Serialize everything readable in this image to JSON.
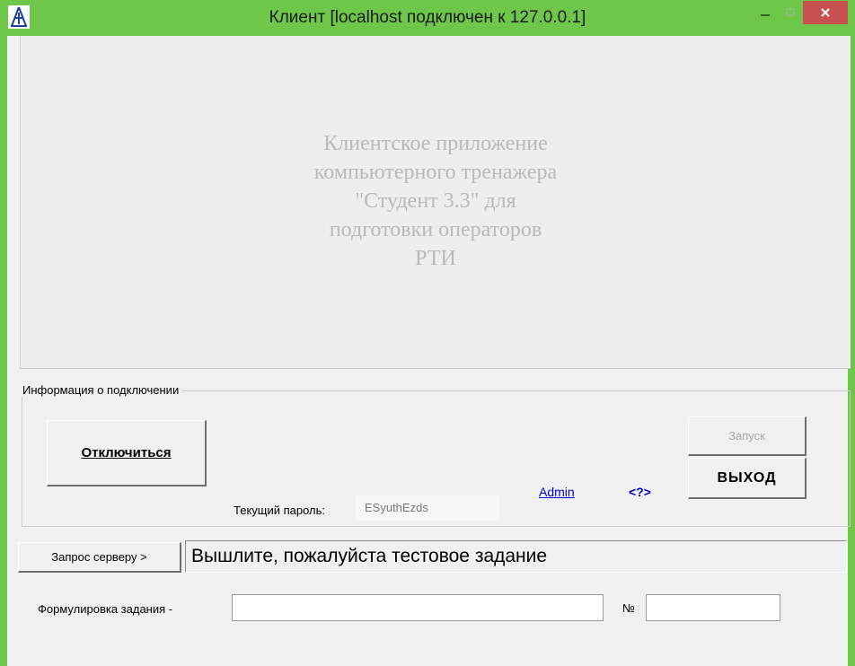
{
  "window": {
    "title": "Клиент [localhost подключен к 127.0.0.1]",
    "icon": "app-logo-icon",
    "frame_color": "#6fc74a",
    "close_color": "#c75050"
  },
  "banner": {
    "lines": [
      "Клиентское приложение",
      "компьютерного тренажера",
      "\"Студент 3.3\" для",
      "подготовки операторов",
      "РТИ"
    ]
  },
  "connection": {
    "legend": "Информация о подключении",
    "disconnect_label": "Отключиться",
    "launch_label": "Запуск",
    "exit_label": "ВЫХОД",
    "password_label": "Текущий пароль:",
    "password_value": "ESyuthEzds",
    "admin_link": "Admin",
    "help_link": "<?>"
  },
  "request": {
    "button_label": "Запрос серверу >",
    "input_value": "Вышлите, пожалуйста тестовое задание"
  },
  "task": {
    "label": "Формулировка задания -",
    "value": "",
    "number_label": "№",
    "number_value": ""
  }
}
